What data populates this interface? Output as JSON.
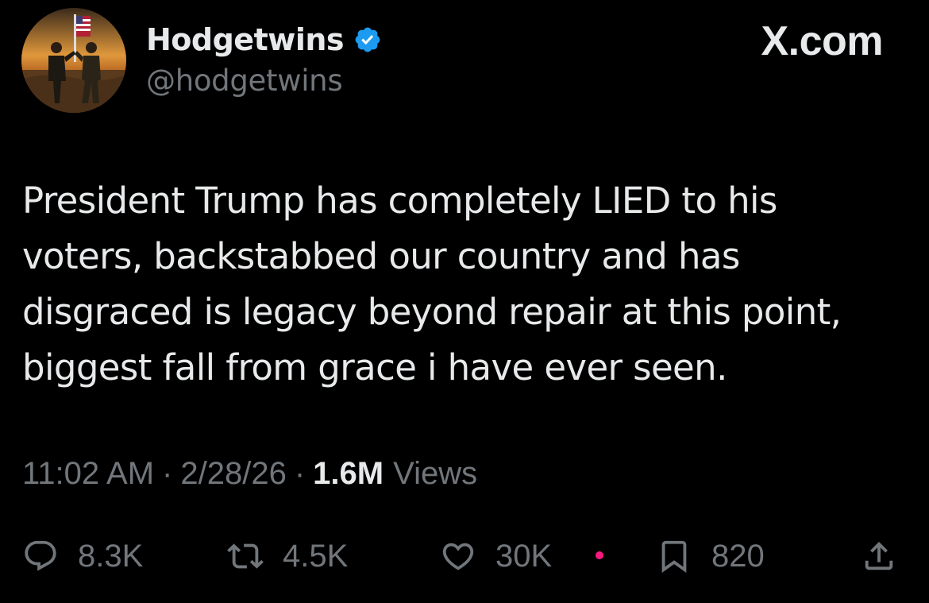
{
  "author": {
    "display_name": "Hodgetwins",
    "handle": "@hodgetwins",
    "verified": true,
    "avatar_icon": "profile-photo",
    "verified_color": "#1d9bf0"
  },
  "brand": {
    "label": "X.com"
  },
  "post": {
    "text": "President Trump has completely LIED to his\nvoters, backstabbed our country and has\ndisgraced is legacy beyond repair at this point,\nbiggest fall from grace i have ever seen."
  },
  "meta": {
    "time": "11:02 AM",
    "separator": "·",
    "date": "2/28/26",
    "views_count": "1.6M",
    "views_label": "Views"
  },
  "actions": {
    "replies": "8.3K",
    "reposts": "4.5K",
    "likes": "30K",
    "bookmarks": "820",
    "icons": [
      "reply-icon",
      "repost-icon",
      "like-icon",
      "bookmark-icon",
      "share-icon"
    ]
  },
  "colors": {
    "background": "#000000",
    "text": "#e7e9ea",
    "muted": "#71767b",
    "accent": "#1d9bf0",
    "notification_dot": "#f91880"
  }
}
